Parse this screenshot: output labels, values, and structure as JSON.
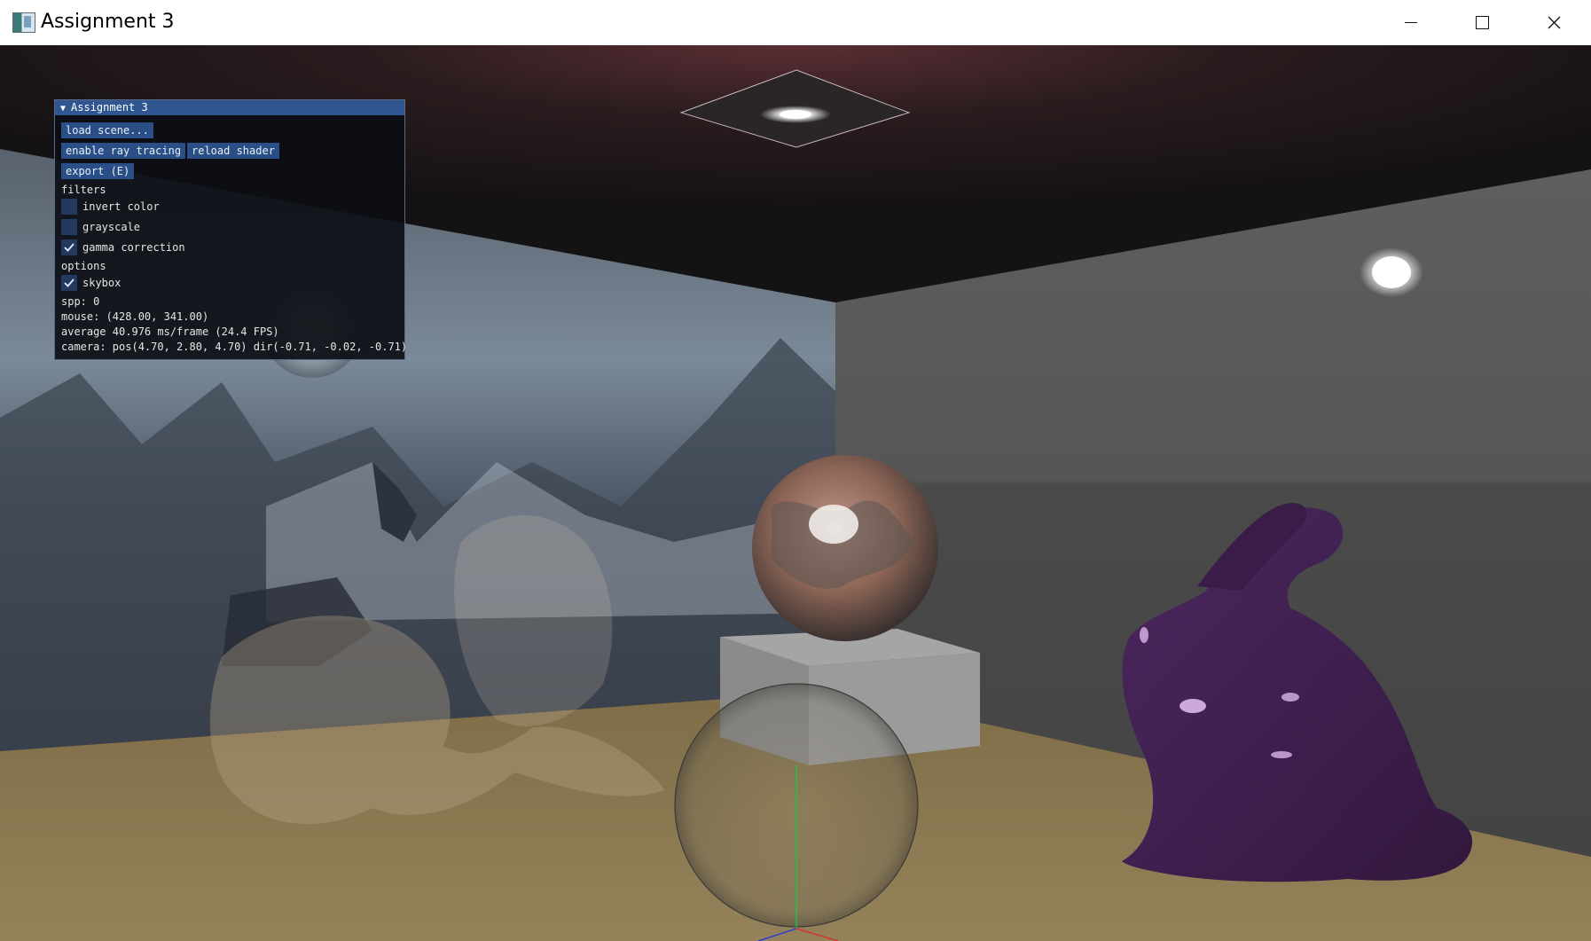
{
  "window": {
    "title": "Assignment 3"
  },
  "panel": {
    "header": "Assignment 3",
    "buttons": {
      "load_scene": "load scene...",
      "enable_ray_tracing": "enable ray tracing",
      "reload_shader": "reload shader",
      "export": "export (E)"
    },
    "filters_heading": "filters",
    "filters": [
      {
        "label": "invert color",
        "checked": false
      },
      {
        "label": "grayscale",
        "checked": false
      },
      {
        "label": "gamma correction",
        "checked": true
      }
    ],
    "options_heading": "options",
    "options": [
      {
        "label": "skybox",
        "checked": true
      }
    ],
    "stats": {
      "spp": "spp: 0",
      "mouse": "mouse: (428.00, 341.00)",
      "average": "average 40.976 ms/frame (24.4 FPS)",
      "camera": "camera: pos(4.70, 2.80, 4.70) dir(-0.71, -0.02, -0.71)"
    }
  },
  "colors": {
    "panel_header": "#2f5690",
    "button": "#2a4f86",
    "checkbox": "#233a5e",
    "floor": "#8f7d55",
    "bunny": "#3e1f4d",
    "ceiling": "#1c1718"
  },
  "icons": [
    "app-icon",
    "minimize-icon",
    "maximize-icon",
    "close-icon",
    "collapse-arrow-icon",
    "checkmark-icon"
  ]
}
